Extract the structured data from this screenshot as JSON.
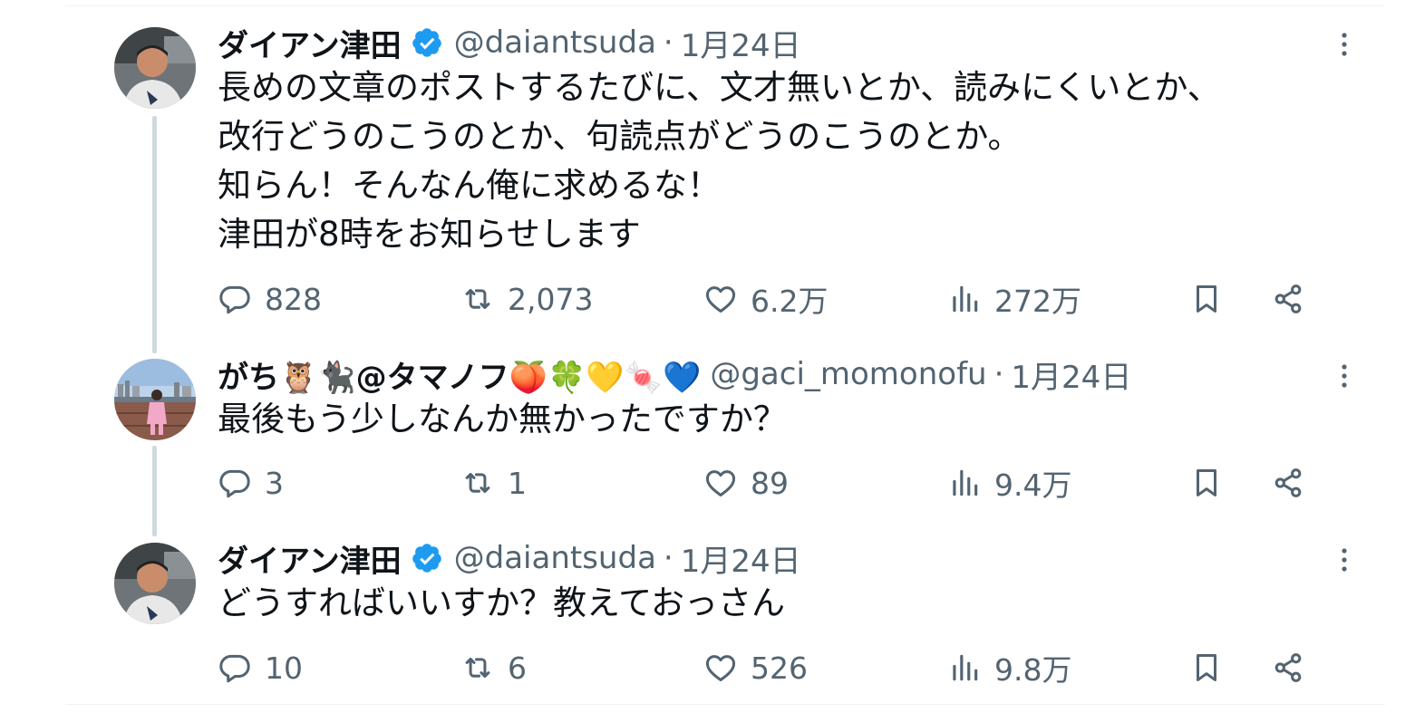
{
  "tweets": [
    {
      "name": "ダイアン津田",
      "verified": true,
      "handle": "@daiantsuda",
      "separator": "·",
      "date": "1月24日",
      "text": "長めの文章のポストするたびに、文才無いとか、読みにくいとか、\n改行どうのこうのとか、句読点がどうのこうのとか。\n知らん！そんなん俺に求めるな！\n津田が8時をお知らせします",
      "replies": "828",
      "retweets": "2,073",
      "likes": "6.2万",
      "views": "272万"
    },
    {
      "name": "がち🦉🐈‍⬛@タマノフ🍑🍀💛🍬💙",
      "verified": false,
      "handle": "@gaci_momonofu",
      "separator": "·",
      "date": "1月24日",
      "text": "最後もう少しなんか無かったですか？",
      "replies": "3",
      "retweets": "1",
      "likes": "89",
      "views": "9.4万"
    },
    {
      "name": "ダイアン津田",
      "verified": true,
      "handle": "@daiantsuda",
      "separator": "·",
      "date": "1月24日",
      "text": "どうすればいいすか？教えておっさん",
      "replies": "10",
      "retweets": "6",
      "likes": "526",
      "views": "9.8万"
    }
  ],
  "icons": {
    "verified": "verified-badge-icon",
    "more": "more-options-icon",
    "reply": "reply-icon",
    "retweet": "retweet-icon",
    "like": "heart-icon",
    "views": "views-icon",
    "bookmark": "bookmark-icon",
    "share": "share-icon"
  },
  "colors": {
    "text": "#0f1419",
    "muted": "#536471",
    "verified": "#1d9bf0",
    "thread_line": "#cfd9de",
    "divider": "#eff3f4"
  }
}
